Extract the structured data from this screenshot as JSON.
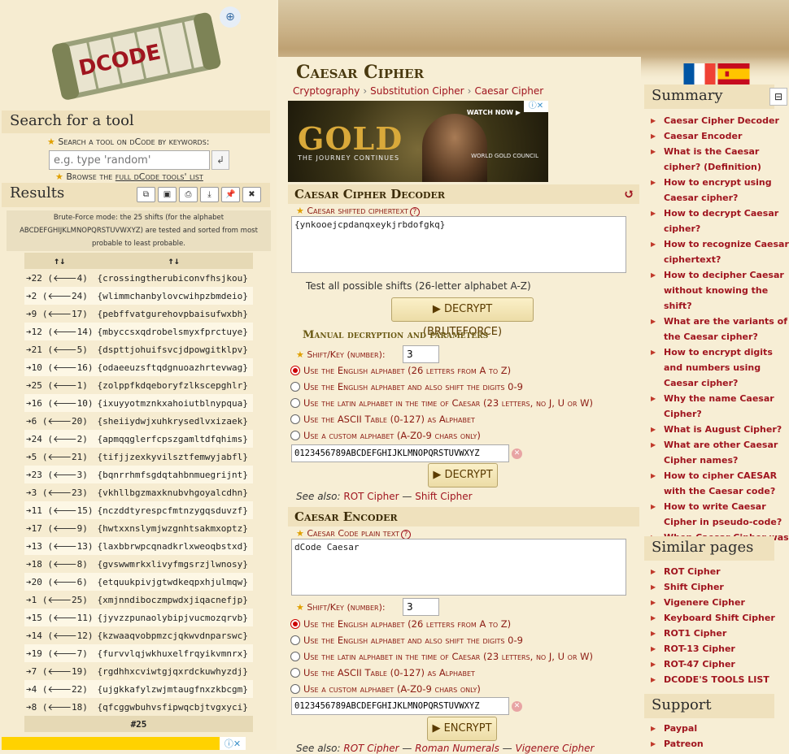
{
  "logo": {
    "text": "DCODE",
    "search_icon": "magnifier-icon"
  },
  "search": {
    "heading": "Search for a tool",
    "label": "Search a tool on dCode by keywords:",
    "placeholder": "e.g. type 'random'",
    "go_icon": "enter-icon"
  },
  "browse": {
    "prefix": "Browse the ",
    "link": "full dCode tools' list"
  },
  "results": {
    "heading": "Results",
    "tool_icons": [
      "copy-icon",
      "save-icon",
      "print-icon",
      "download-icon",
      "pin-icon",
      "close-icon"
    ],
    "note": "Brute-Force mode: the 25 shifts (for the alphabet ABCDEFGHIJKLMNOPQRSTUVWXYZ) are tested and sorted from most probable to least probable.",
    "col_headers": [
      "↑↓",
      "↑↓"
    ],
    "rows": [
      [
        "➔22 (🡐4)",
        "{crossingtherubiconvfhsjkou}"
      ],
      [
        "➔2 (🡐24)",
        "{wlimmchanbylovcwihpzbmdeio}"
      ],
      [
        "➔9 (🡐17)",
        "{pebffvatgurehovpbaisufwxbh}"
      ],
      [
        "➔12 (🡐14)",
        "{mbyccsxqdrobelsmyxfprctuye}"
      ],
      [
        "➔21 (🡐5)",
        "{dspttjohuifsvcjdpowgitklpv}"
      ],
      [
        "➔10 (🡐16)",
        "{odaeeuzsftqdgnuoazhrtevwag}"
      ],
      [
        "➔25 (🡐1)",
        "{zolppfkdqeboryfzlkscepghlr}"
      ],
      [
        "➔16 (🡐10)",
        "{ixuyyotmznkxahoiutblnypqua}"
      ],
      [
        "➔6 (🡐20)",
        "{sheiiydwjxuhkrysedlvxizaek}"
      ],
      [
        "➔24 (🡐2)",
        "{apmqqglerfcpszgamltdfqhims}"
      ],
      [
        "➔5 (🡐21)",
        "{tifjjzexkyvilsztfemwyjabfl}"
      ],
      [
        "➔23 (🡐3)",
        "{bqnrrhmfsgdqtahbnmuegrijnt}"
      ],
      [
        "➔3 (🡐23)",
        "{vkhllbgzmaxknubvhgoyalcdhn}"
      ],
      [
        "➔11 (🡐15)",
        "{nczddtyrespcfmtnzygqsduvzf}"
      ],
      [
        "➔17 (🡐9)",
        "{hwtxxnslymjwzgnhtsakmxoptz}"
      ],
      [
        "➔13 (🡐13)",
        "{laxbbrwpcqnadkrlxweoqbstxd}"
      ],
      [
        "➔18 (🡐8)",
        "{gvswwmrkxlivyfmgsrzjlwnosy}"
      ],
      [
        "➔20 (🡐6)",
        "{etquukpivjgtwdkeqpxhjulmqw}"
      ],
      [
        "➔1 (🡐25)",
        "{xmjnndiboczmpwdxjiqacnefjp}"
      ],
      [
        "➔15 (🡐11)",
        "{jyvzzpunaolybipjvucmozqrvb}"
      ],
      [
        "➔14 (🡐12)",
        "{kzwaaqvobpmzcjqkwvdnparswc}"
      ],
      [
        "➔19 (🡐7)",
        "{furvvlqjwkhuxelfrqyikvmnrx}"
      ],
      [
        "➔7 (🡐19)",
        "{rgdhhxcviwtgjqxrdckuwhyzdj}"
      ],
      [
        "➔4 (🡐22)",
        "{ujgkkafylzwjmtaugfnxzkbcgm}"
      ],
      [
        "➔8 (🡐18)",
        "{qfcggwbuhvsfipwqcbjtvgxyci}"
      ]
    ],
    "footer": "#25"
  },
  "page": {
    "title": "Caesar Cipher",
    "breadcrumb": [
      "Cryptography",
      "Substitution Cipher",
      "Caesar Cipher"
    ]
  },
  "ad": {
    "headline": "GOLD",
    "tagline": "THE JOURNEY CONTINUES",
    "watch": "WATCH NOW ▶",
    "sponsor": "WORLD GOLD COUNCIL"
  },
  "decoder": {
    "heading": "Caesar Cipher Decoder",
    "reload_icon": "reload-icon",
    "field_label": "Caesar shifted ciphertext",
    "ciphertext": "{ynkooejcpdanqxeykjrbdofgkq}",
    "test_all": "Test all possible shifts (26-letter alphabet A-Z)",
    "brute_button": "▶ DECRYPT (BRUTEFORCE)",
    "manual_heading": "Manual decryption and parameters",
    "key_label": "Shift/Key (number):",
    "key_value": "3",
    "options": [
      "Use the English alphabet (26 letters from A to Z)",
      "Use the English alphabet and also shift the digits 0-9",
      "Use the latin alphabet in the time of Caesar (23 letters, no J, U or W)",
      "Use the ASCII Table (0-127) as Alphabet",
      "Use a custom alphabet (A-Z0-9 chars only)"
    ],
    "selected_option": 0,
    "custom_alphabet": "0123456789ABCDEFGHIJKLMNOPQRSTUVWXYZ",
    "decrypt_button": "▶ DECRYPT",
    "see_also_label": "See also:",
    "see_also_links": [
      "ROT Cipher",
      "Shift Cipher"
    ],
    "see_also_sep": "—"
  },
  "encoder": {
    "heading": "Caesar Encoder",
    "field_label": "Caesar Code plain text",
    "plaintext": "dCode Caesar",
    "key_label": "Shift/Key (number):",
    "key_value": "3",
    "options": [
      "Use the English alphabet (26 letters from A to Z)",
      "Use the English alphabet and also shift the digits 0-9",
      "Use the latin alphabet in the time of Caesar (23 letters, no J, U or W)",
      "Use the ASCII Table (0-127) as Alphabet",
      "Use a custom alphabet (A-Z0-9 chars only)"
    ],
    "selected_option": 0,
    "custom_alphabet": "0123456789ABCDEFGHIJKLMNOPQRSTUVWXYZ",
    "encrypt_button": "▶ ENCRYPT",
    "see_also_label": "See also:",
    "see_also_links": [
      "ROT Cipher",
      "Roman Numerals",
      "Vigenere Cipher"
    ]
  },
  "flags": [
    "flag-fr-icon",
    "flag-es-icon"
  ],
  "summary": {
    "heading": "Summary",
    "toggle": "⊟",
    "items": [
      "Caesar Cipher Decoder",
      "Caesar Encoder",
      "What is the Caesar cipher? (Definition)",
      "How to encrypt using Caesar cipher?",
      "How to decrypt Caesar cipher?",
      "How to recognize Caesar ciphertext?",
      "How to decipher Caesar without knowing the shift?",
      "What are the variants of the Caesar cipher?",
      "How to encrypt digits and numbers using Caesar cipher?",
      "Why the name Caesar Cipher?",
      "What is August Cipher?",
      "What are other Caesar Cipher names?",
      "How to cipher CAESAR with the Caesar code?",
      "How to write Caesar Cipher in pseudo-code?",
      "When Caesar Cipher was invented?"
    ]
  },
  "similar": {
    "heading": "Similar pages",
    "items": [
      "ROT Cipher",
      "Shift Cipher",
      "Vigenere Cipher",
      "Keyboard Shift Cipher",
      "ROT1 Cipher",
      "ROT-13 Cipher",
      "ROT-47 Cipher",
      "DCODE'S TOOLS LIST"
    ]
  },
  "support": {
    "heading": "Support",
    "items": [
      "Paypal",
      "Patreon"
    ]
  }
}
